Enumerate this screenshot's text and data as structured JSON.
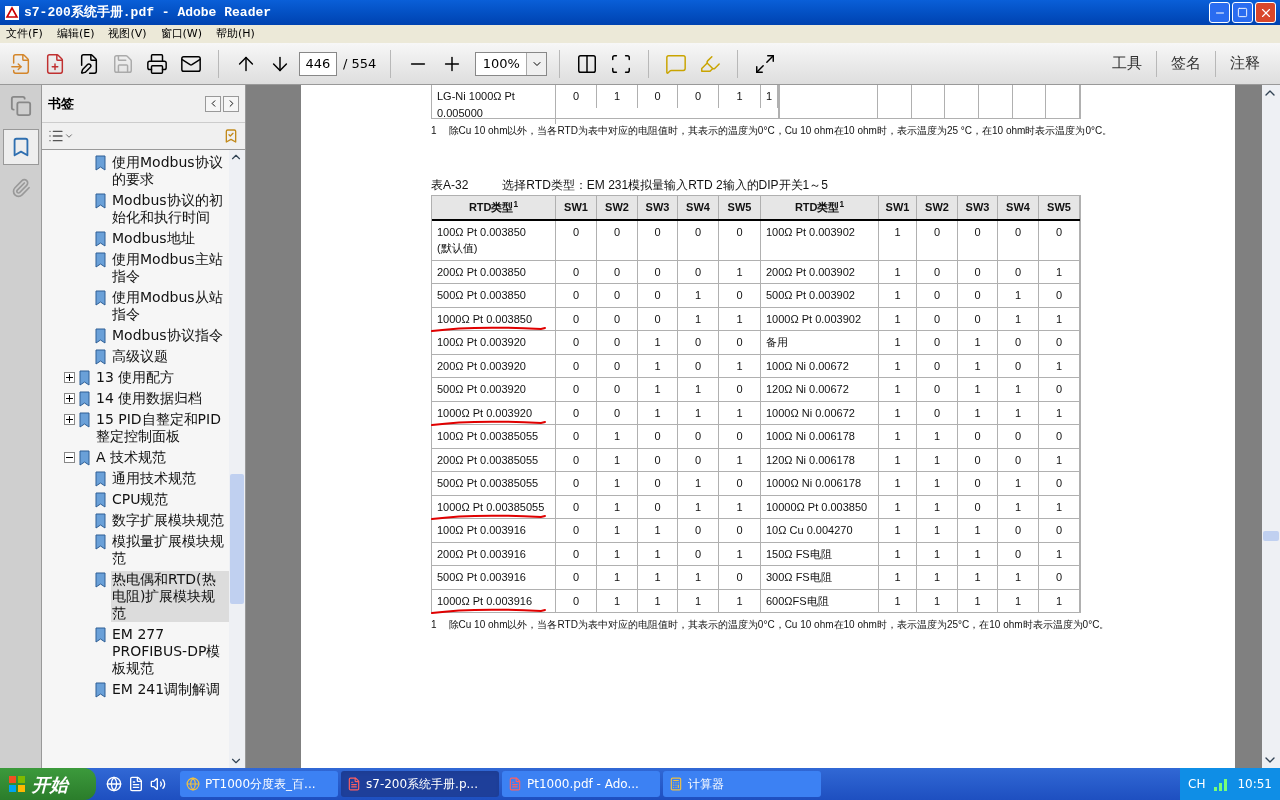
{
  "window": {
    "title": "s7-200系统手册.pdf - Adobe Reader"
  },
  "menu": [
    "文件(F)",
    "编辑(E)",
    "视图(V)",
    "窗口(W)",
    "帮助(H)"
  ],
  "toolbar": {
    "page": "446",
    "total": "/ 554",
    "zoom": "100%",
    "right_buttons": [
      "工具",
      "签名",
      "注释"
    ]
  },
  "sidebar": {
    "title": "书签",
    "continued_children": [
      {
        "label": "使用Modbus协议的要求",
        "selected": false
      },
      {
        "label": "Modbus协议的初始化和执行时间",
        "selected": false
      },
      {
        "label": "Modbus地址",
        "selected": false
      },
      {
        "label": "使用Modbus主站指令",
        "selected": false
      },
      {
        "label": "使用Modbus从站指令",
        "selected": false
      },
      {
        "label": "Modbus协议指令",
        "selected": false
      },
      {
        "label": "高级议题",
        "selected": false
      }
    ],
    "items": [
      {
        "label": "13 使用配方",
        "expanded": false,
        "selected": false
      },
      {
        "label": "14 使用数据归档",
        "expanded": false,
        "selected": false
      },
      {
        "label": "15 PID自整定和PID整定控制面板",
        "expanded": false,
        "selected": false
      },
      {
        "label": "A 技术规范",
        "expanded": true,
        "selected": false,
        "children": [
          {
            "label": "通用技术规范",
            "selected": false
          },
          {
            "label": "CPU规范",
            "selected": false
          },
          {
            "label": "数字扩展模块规范",
            "selected": false
          },
          {
            "label": "模拟量扩展模块规范",
            "selected": false
          },
          {
            "label": "热电偶和RTD(热电阻)扩展模块规范",
            "selected": true
          },
          {
            "label": "EM 277 PROFIBUS-DP模板规范",
            "selected": false
          },
          {
            "label": "EM 241调制解调",
            "selected": false
          }
        ]
      }
    ]
  },
  "document": {
    "prev_table_row": {
      "type": "LG-Ni 1000Ω Pt 0.005000",
      "sw": [
        "0",
        "1",
        "0",
        "0",
        "1",
        "1"
      ]
    },
    "prev_footnote": {
      "mark": "1",
      "text": "除Cu 10 ohm以外，当各RTD为表中对应的电阻值时，其表示的温度为0°C，Cu 10 ohm在10 ohm时，表示温度为25 °C，在10 ohm时表示温度为0°C。"
    },
    "table_caption": {
      "number": "表A-32",
      "title": "选择RTD类型：EM 231模拟量输入RTD 2输入的DIP开关1～5"
    },
    "columns": [
      "RTD类型$^{1}$",
      "SW1",
      "SW2",
      "SW3",
      "SW4",
      "SW5",
      "RTD类型$^{1}$",
      "SW1",
      "SW2",
      "SW3",
      "SW4",
      "SW5"
    ],
    "rows": [
      {
        "left": {
          "type": "100Ω Pt 0.003850 (默认值)",
          "sw": [
            "0",
            "0",
            "0",
            "0",
            "0"
          ],
          "underlined": false
        },
        "right": {
          "type": "100Ω Pt 0.003902",
          "sw": [
            "1",
            "0",
            "0",
            "0",
            "0"
          ]
        }
      },
      {
        "left": {
          "type": "200Ω Pt 0.003850",
          "sw": [
            "0",
            "0",
            "0",
            "0",
            "1"
          ],
          "underlined": false
        },
        "right": {
          "type": "200Ω Pt 0.003902",
          "sw": [
            "1",
            "0",
            "0",
            "0",
            "1"
          ]
        }
      },
      {
        "left": {
          "type": "500Ω Pt 0.003850",
          "sw": [
            "0",
            "0",
            "0",
            "1",
            "0"
          ],
          "underlined": false
        },
        "right": {
          "type": "500Ω Pt 0.003902",
          "sw": [
            "1",
            "0",
            "0",
            "1",
            "0"
          ]
        }
      },
      {
        "left": {
          "type": "1000Ω Pt 0.003850",
          "sw": [
            "0",
            "0",
            "0",
            "1",
            "1"
          ],
          "underlined": true
        },
        "right": {
          "type": "1000Ω Pt 0.003902",
          "sw": [
            "1",
            "0",
            "0",
            "1",
            "1"
          ]
        }
      },
      {
        "left": {
          "type": "100Ω Pt 0.003920",
          "sw": [
            "0",
            "0",
            "1",
            "0",
            "0"
          ],
          "underlined": false
        },
        "right": {
          "type": "备用",
          "sw": [
            "1",
            "0",
            "1",
            "0",
            "0"
          ]
        }
      },
      {
        "left": {
          "type": "200Ω Pt 0.003920",
          "sw": [
            "0",
            "0",
            "1",
            "0",
            "1"
          ],
          "underlined": false
        },
        "right": {
          "type": "100Ω Ni 0.00672",
          "sw": [
            "1",
            "0",
            "1",
            "0",
            "1"
          ]
        }
      },
      {
        "left": {
          "type": "500Ω Pt 0.003920",
          "sw": [
            "0",
            "0",
            "1",
            "1",
            "0"
          ],
          "underlined": false
        },
        "right": {
          "type": "120Ω Ni 0.00672",
          "sw": [
            "1",
            "0",
            "1",
            "1",
            "0"
          ]
        }
      },
      {
        "left": {
          "type": "1000Ω Pt 0.003920",
          "sw": [
            "0",
            "0",
            "1",
            "1",
            "1"
          ],
          "underlined": true
        },
        "right": {
          "type": "1000Ω Ni 0.00672",
          "sw": [
            "1",
            "0",
            "1",
            "1",
            "1"
          ]
        }
      },
      {
        "left": {
          "type": "100Ω Pt 0.00385055",
          "sw": [
            "0",
            "1",
            "0",
            "0",
            "0"
          ],
          "underlined": false
        },
        "right": {
          "type": "100Ω Ni 0.006178",
          "sw": [
            "1",
            "1",
            "0",
            "0",
            "0"
          ]
        }
      },
      {
        "left": {
          "type": "200Ω Pt 0.00385055",
          "sw": [
            "0",
            "1",
            "0",
            "0",
            "1"
          ],
          "underlined": false
        },
        "right": {
          "type": "120Ω Ni 0.006178",
          "sw": [
            "1",
            "1",
            "0",
            "0",
            "1"
          ]
        }
      },
      {
        "left": {
          "type": "500Ω Pt 0.00385055",
          "sw": [
            "0",
            "1",
            "0",
            "1",
            "0"
          ],
          "underlined": false
        },
        "right": {
          "type": "1000Ω Ni 0.006178",
          "sw": [
            "1",
            "1",
            "0",
            "1",
            "0"
          ]
        }
      },
      {
        "left": {
          "type": "1000Ω Pt 0.00385055",
          "sw": [
            "0",
            "1",
            "0",
            "1",
            "1"
          ],
          "underlined": true
        },
        "right": {
          "type": "10000Ω Pt 0.003850",
          "sw": [
            "1",
            "1",
            "0",
            "1",
            "1"
          ]
        }
      },
      {
        "left": {
          "type": "100Ω Pt 0.003916",
          "sw": [
            "0",
            "1",
            "1",
            "0",
            "0"
          ],
          "underlined": false
        },
        "right": {
          "type": "10Ω Cu 0.004270",
          "sw": [
            "1",
            "1",
            "1",
            "0",
            "0"
          ]
        }
      },
      {
        "left": {
          "type": "200Ω Pt 0.003916",
          "sw": [
            "0",
            "1",
            "1",
            "0",
            "1"
          ],
          "underlined": false
        },
        "right": {
          "type": "150Ω FS电阻",
          "sw": [
            "1",
            "1",
            "1",
            "0",
            "1"
          ]
        }
      },
      {
        "left": {
          "type": "500Ω Pt 0.003916",
          "sw": [
            "0",
            "1",
            "1",
            "1",
            "0"
          ],
          "underlined": false
        },
        "right": {
          "type": "300Ω FS电阻",
          "sw": [
            "1",
            "1",
            "1",
            "1",
            "0"
          ]
        }
      },
      {
        "left": {
          "type": "1000Ω Pt 0.003916",
          "sw": [
            "0",
            "1",
            "1",
            "1",
            "1"
          ],
          "underlined": true
        },
        "right": {
          "type": "600ΩFS电阻",
          "sw": [
            "1",
            "1",
            "1",
            "1",
            "1"
          ]
        }
      }
    ],
    "footnote": {
      "mark": "1",
      "text": "除Cu 10 ohm以外，当各RTD为表中对应的电阻值时，其表示的温度为0°C，Cu 10 ohm在10 ohm时，表示温度为25°C，在10 ohm时表示温度为0°C。"
    }
  },
  "taskbar": {
    "start": "开始",
    "tasks": [
      {
        "label": "PT1000分度表_百...",
        "kind": "browser",
        "selected": false
      },
      {
        "label": "s7-200系统手册.p...",
        "kind": "pdf",
        "selected": true
      },
      {
        "label": "Pt1000.pdf - Ado...",
        "kind": "pdf",
        "selected": false
      },
      {
        "label": "计算器",
        "kind": "calculator",
        "selected": false
      }
    ],
    "language": "CH",
    "clock": "10:51"
  }
}
